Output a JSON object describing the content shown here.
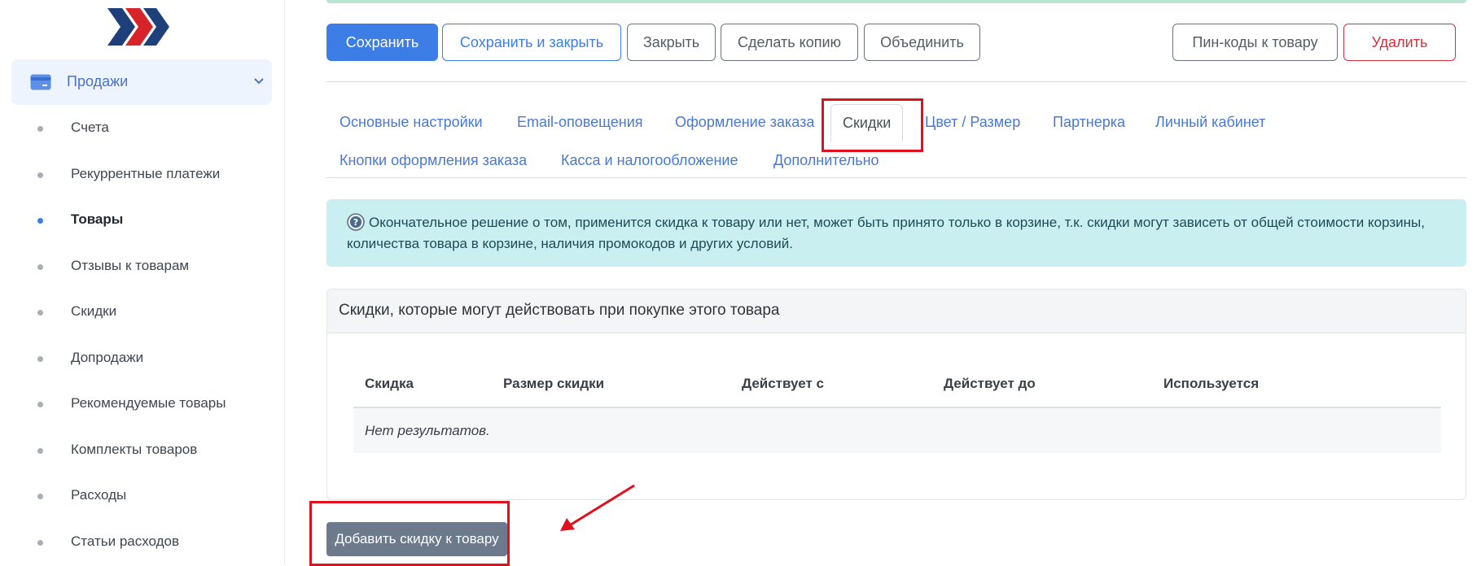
{
  "sidebar": {
    "group": {
      "label": "Продажи",
      "expanded": true
    },
    "items": [
      {
        "label": "Счета",
        "active": false
      },
      {
        "label": "Рекуррентные платежи",
        "active": false
      },
      {
        "label": "Товары",
        "active": true
      },
      {
        "label": "Отзывы к товарам",
        "active": false
      },
      {
        "label": "Скидки",
        "active": false
      },
      {
        "label": "Допродажи",
        "active": false
      },
      {
        "label": "Рекомендуемые товары",
        "active": false
      },
      {
        "label": "Комплекты товаров",
        "active": false
      },
      {
        "label": "Расходы",
        "active": false
      },
      {
        "label": "Статьи расходов",
        "active": false
      }
    ]
  },
  "toolbar": {
    "save": "Сохранить",
    "save_close": "Сохранить и закрыть",
    "close": "Закрыть",
    "copy": "Сделать копию",
    "merge": "Объединить",
    "pin_codes": "Пин-коды к товару",
    "delete": "Удалить"
  },
  "tabs": {
    "row1": [
      "Основные настройки",
      "Email-оповещения",
      "Оформление заказа",
      "Скидки",
      "Цвет / Размер",
      "Партнерка",
      "Личный кабинет"
    ],
    "row2": [
      "Кнопки оформления заказа",
      "Касса и налогообложение",
      "Дополнительно"
    ],
    "active": "Скидки"
  },
  "info": {
    "text": "Окончательное решение о том, применится скидка к товару или нет, может быть принято только в корзине, т.к. скидки могут зависеть от общей стоимости корзины, количества товара в корзине, наличия промокодов и других условий."
  },
  "discounts_card": {
    "title": "Скидки, которые могут действовать при покупке этого товара",
    "columns": [
      "Скидка",
      "Размер скидки",
      "Действует с",
      "Действует до",
      "Используется"
    ],
    "empty_text": "Нет результатов."
  },
  "add_button": "Добавить скидку к товару",
  "colors": {
    "primary": "#3d7de6",
    "danger": "#d9303c",
    "annotation": "#e0101d",
    "info_bg": "#c9eff0"
  },
  "icons": [
    "logo-chevrons-icon",
    "credit-card-icon",
    "chevron-down-icon",
    "question-icon",
    "annotation-arrow-icon"
  ]
}
